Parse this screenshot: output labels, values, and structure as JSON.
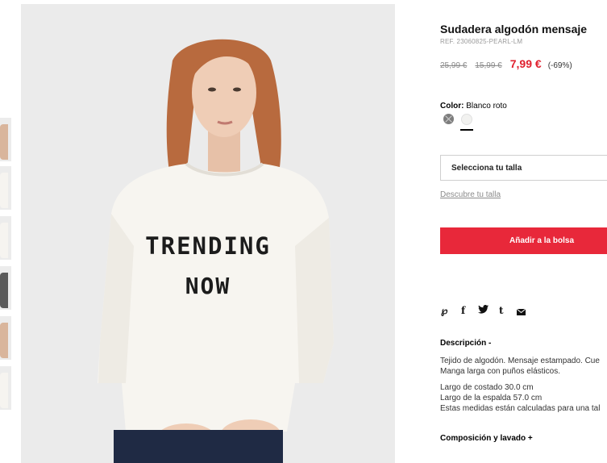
{
  "product": {
    "title": "Sudadera algodón mensaje",
    "ref": "REF. 23060825-PEARL-LM",
    "price_original": "25,99 €",
    "price_previous": "15,99 €",
    "price_current": "7,99 €",
    "discount": "(-69%)"
  },
  "image": {
    "print_line1": "TRENDING",
    "print_line2": "NOW"
  },
  "color": {
    "label": "Color:",
    "value": "Blanco roto",
    "swatches": [
      "#7d7d7d",
      "#f2f2f0"
    ]
  },
  "size": {
    "select_label": "Selecciona tu talla",
    "guide_link": "Descubre tu talla"
  },
  "cart": {
    "add_label": "Añadir a la bolsa"
  },
  "share": {
    "icons": [
      "pinterest-icon",
      "facebook-icon",
      "twitter-icon",
      "tumblr-icon",
      "email-icon"
    ]
  },
  "description": {
    "heading": "Descripción -",
    "text_line1": "Tejido de algodón. Mensaje estampado. Cue",
    "text_line2": "Manga larga con puños elásticos.",
    "measure_line1": "Largo de costado 30.0 cm",
    "measure_line2": "Largo de la espalda 57.0 cm",
    "measure_line3": "Estas medidas están calculadas para una tal"
  },
  "composition": {
    "heading": "Composición y lavado +"
  },
  "colors": {
    "accent": "#e8283a",
    "price_red": "#e0202e"
  }
}
